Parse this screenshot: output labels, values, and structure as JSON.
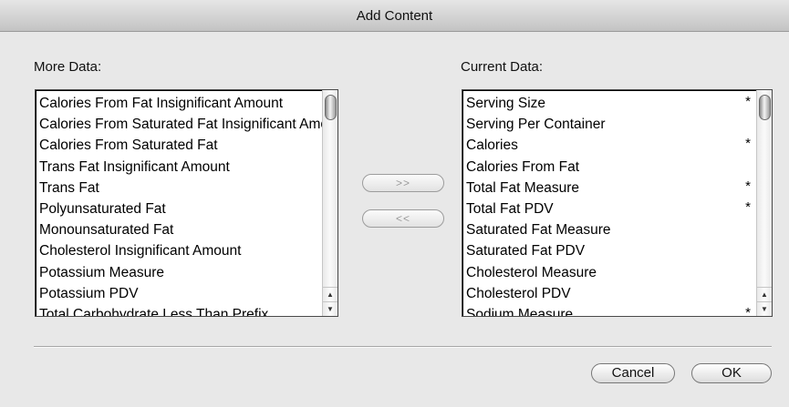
{
  "window": {
    "title": "Add Content"
  },
  "more_data": {
    "label": "More Data:",
    "items": [
      "Calories From Fat Insignificant Amount",
      "Calories From Saturated Fat Insignificant Amount",
      "Calories From Saturated Fat",
      "Trans Fat Insignificant Amount",
      "Trans Fat",
      "Polyunsaturated Fat",
      "Monounsaturated Fat",
      "Cholesterol Insignificant Amount",
      "Potassium Measure",
      "Potassium PDV",
      "Total Carbohydrate Less Than Prefix"
    ]
  },
  "current_data": {
    "label": "Current Data:",
    "items": [
      {
        "label": "Serving Size",
        "mark": "*"
      },
      {
        "label": "Serving Per Container",
        "mark": ""
      },
      {
        "label": "Calories",
        "mark": "*"
      },
      {
        "label": "Calories From Fat",
        "mark": ""
      },
      {
        "label": "Total Fat Measure",
        "mark": "*"
      },
      {
        "label": "Total Fat PDV",
        "mark": "*"
      },
      {
        "label": "Saturated Fat Measure",
        "mark": ""
      },
      {
        "label": "Saturated Fat PDV",
        "mark": ""
      },
      {
        "label": "Cholesterol Measure",
        "mark": ""
      },
      {
        "label": "Cholesterol PDV",
        "mark": ""
      },
      {
        "label": "Sodium Measure",
        "mark": "*"
      }
    ]
  },
  "transfer": {
    "add_label": ">>",
    "remove_label": "<<"
  },
  "scroll": {
    "up_icon": "▲",
    "down_icon": "▼"
  },
  "buttons": {
    "cancel_label": "Cancel",
    "ok_label": "OK"
  }
}
